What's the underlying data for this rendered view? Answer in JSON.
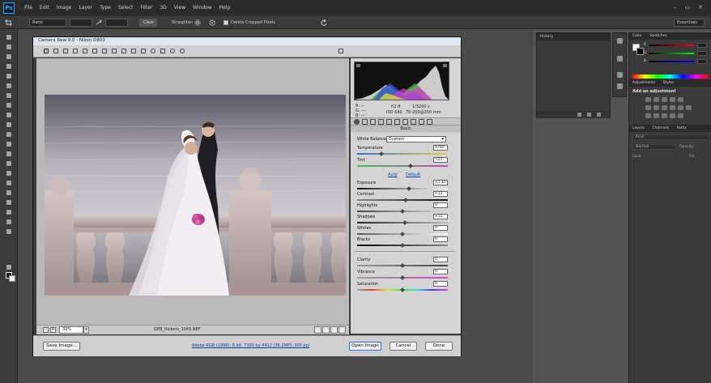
{
  "app": {
    "logo": "Ps",
    "menu": [
      "File",
      "Edit",
      "Image",
      "Layer",
      "Type",
      "Select",
      "Filter",
      "3D",
      "View",
      "Window",
      "Help"
    ],
    "window_controls": [
      "–",
      "▭",
      "✕"
    ]
  },
  "options_bar": {
    "ratio_label": "Ratio",
    "clear_label": "Clear",
    "straighten_label": "Straighten",
    "delete_cropped_label": "Delete Cropped Pixels",
    "workspace": "Essentials"
  },
  "camera_raw": {
    "title": "Camera Raw 9.0  -  Nikon D800",
    "readout": {
      "rgb_labels": [
        "R:",
        "G:",
        "B:"
      ],
      "rgb_values": [
        "---",
        "---",
        "---"
      ],
      "aperture": "f/2.8",
      "shutter": "1/3200 s",
      "iso": "ISO 640",
      "lens": "70-200@200 mm"
    },
    "panel_header": "Basic",
    "white_balance_label": "White Balance:",
    "white_balance_value": "Custom",
    "auto_label": "Auto",
    "default_label": "Default",
    "controls": [
      {
        "label": "Temperature",
        "value": "4700"
      },
      {
        "label": "Tint",
        "value": "+23"
      },
      {
        "label": "Exposure",
        "value": "+1.15"
      },
      {
        "label": "Contrast",
        "value": "+12"
      },
      {
        "label": "Highlights",
        "value": "0"
      },
      {
        "label": "Shadows",
        "value": "+11"
      },
      {
        "label": "Whites",
        "value": "0"
      },
      {
        "label": "Blacks",
        "value": "0"
      },
      {
        "label": "Clarity",
        "value": "0"
      },
      {
        "label": "Vibrance",
        "value": "0"
      },
      {
        "label": "Saturation",
        "value": "0"
      }
    ],
    "zoom_minus": "–",
    "zoom_plus": "+",
    "zoom_value": "32%",
    "zoom_dropdown": "▾",
    "filename": "GEB_Rickers_1045.NEF",
    "workflow_link": "Adobe RGB (1998); 8 bit; 7360 by 4912 (36.2MP); 300 ppi",
    "buttons": {
      "save_image": "Save Image...",
      "open_image": "Open Image",
      "cancel": "Cancel",
      "done": "Done"
    }
  },
  "panels": {
    "history_tab": "History",
    "color_tabs": [
      "Color",
      "Swatches"
    ],
    "color_channels": [
      "R",
      "G",
      "B"
    ],
    "adjustments_tabs": [
      "Adjustments",
      "Styles"
    ],
    "add_adjustment": "Add an adjustment",
    "layers_tabs": [
      "Layers",
      "Channels",
      "Paths"
    ],
    "layers_kind": "Kind",
    "layers_mode": "Normal",
    "layers_opacity": "Opacity:",
    "layers_lock": "Lock:",
    "layers_fill": "Fill:"
  }
}
